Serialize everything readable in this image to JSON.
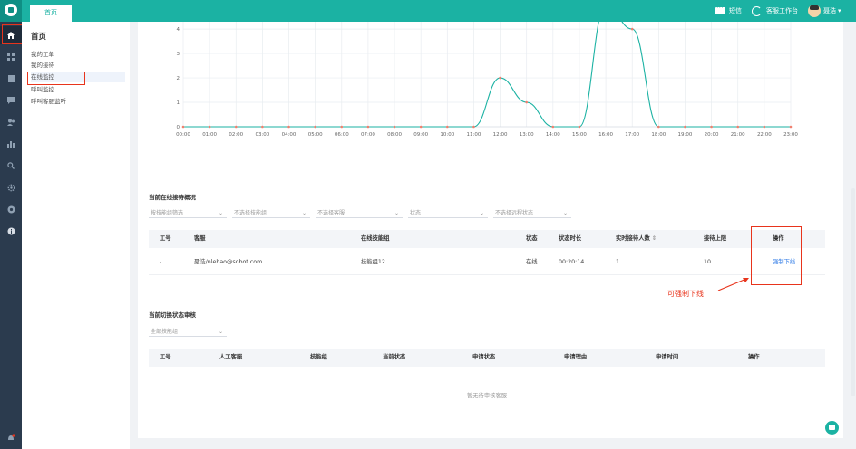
{
  "header": {
    "tab_home": "首页",
    "sms_label": "短信",
    "workspace_label": "客服工作台",
    "user_name": "聂浩",
    "user_caret": "▾"
  },
  "subnav": {
    "title": "首页",
    "items": [
      {
        "label": "我的工单"
      },
      {
        "label": "我的接待"
      },
      {
        "label": "在线监控"
      },
      {
        "label": "呼叫监控"
      },
      {
        "label": "呼叫客服监听"
      }
    ]
  },
  "chart_data": {
    "type": "line",
    "x": [
      "00:00",
      "01:00",
      "02:00",
      "03:00",
      "04:00",
      "05:00",
      "06:00",
      "07:00",
      "08:00",
      "09:00",
      "10:00",
      "11:00",
      "12:00",
      "13:00",
      "14:00",
      "15:00",
      "16:00",
      "17:00",
      "18:00",
      "19:00",
      "20:00",
      "21:00",
      "22:00",
      "23:00"
    ],
    "series": [
      {
        "values": [
          0,
          0,
          0,
          0,
          0,
          0,
          0,
          0,
          0,
          0,
          0,
          0,
          2,
          1,
          0,
          0,
          5,
          4,
          0,
          0,
          0,
          0,
          0,
          0
        ]
      }
    ],
    "y_ticks": [
      0,
      1,
      2,
      3,
      4
    ],
    "ylim": [
      0,
      4.3
    ],
    "grid": true,
    "colors": {
      "line": "#1bb2a3",
      "marker": "#f0806f",
      "grid": "#e8ecf0"
    }
  },
  "online_section": {
    "title": "当前在线接待概况",
    "filters": [
      {
        "placeholder": "按技能组筛选"
      },
      {
        "placeholder": "不选择技能组"
      },
      {
        "placeholder": "不选择客服"
      },
      {
        "placeholder": "状态"
      },
      {
        "placeholder": "不选择远程状态"
      }
    ],
    "columns": [
      "工号",
      "客服",
      "在线技能组",
      "状态",
      "状态时长",
      "实时接待人数",
      "接待上限",
      "操作"
    ],
    "sort_glyph": "⇕",
    "rows": [
      {
        "id": "-",
        "agent": "聂浩/nlehao@sobot.com",
        "group": "技能组12",
        "status": "在线",
        "duration": "00:20:14",
        "realtime": "1",
        "limit": "10",
        "action": "强制下线"
      }
    ],
    "annotation": "可强制下线"
  },
  "audit_section": {
    "title": "当前切换状态审核",
    "filter": "全部技能组",
    "columns": [
      "工号",
      "人工客服",
      "技能组",
      "当前状态",
      "申请状态",
      "申请理由",
      "申请时间",
      "操作"
    ],
    "empty_text": "暂无待审核客服"
  },
  "colors": {
    "accent": "#1bb2a3",
    "nav_bg": "#2b3b4e",
    "highlight": "#e8341c",
    "link": "#2e7ae6"
  }
}
